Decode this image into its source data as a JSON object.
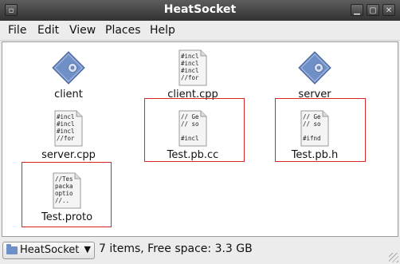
{
  "window": {
    "title": "HeatSocket"
  },
  "menu": [
    "File",
    "Edit",
    "View",
    "Places",
    "Help"
  ],
  "files": [
    {
      "name": "client",
      "kind": "executable",
      "preview": []
    },
    {
      "name": "client.cpp",
      "kind": "text",
      "preview": [
        "#incl",
        "#incl",
        "#incl",
        "//for"
      ]
    },
    {
      "name": "server",
      "kind": "executable",
      "preview": []
    },
    {
      "name": "server.cpp",
      "kind": "text",
      "preview": [
        "#incl",
        "#incl",
        "#incl",
        "//for"
      ]
    },
    {
      "name": "Test.pb.cc",
      "kind": "text",
      "preview": [
        "// Ge",
        "// so",
        "",
        "#incl"
      ]
    },
    {
      "name": "Test.pb.h",
      "kind": "text",
      "preview": [
        "// Ge",
        "// so",
        "",
        "#ifnd"
      ]
    },
    {
      "name": "Test.proto",
      "kind": "text",
      "preview": [
        "//Tes",
        "packa",
        "optio",
        "//.."
      ]
    }
  ],
  "status": {
    "location": "HeatSocket",
    "summary": "7 items, Free space: 3.3 GB"
  },
  "colors": {
    "highlight_box": "#d62728",
    "exec_icon": "#6f8fc7"
  }
}
